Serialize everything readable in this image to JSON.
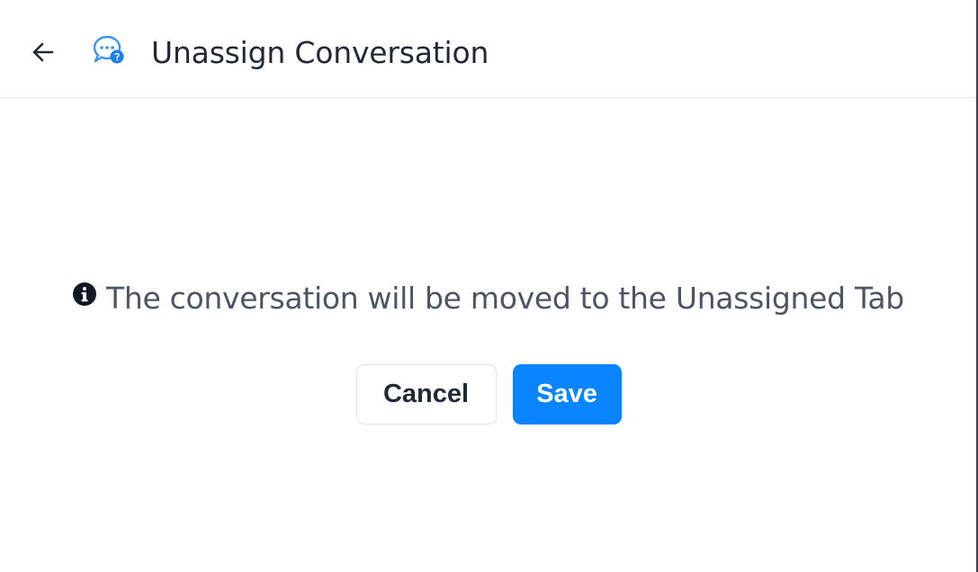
{
  "header": {
    "back_icon": "arrow-left-icon",
    "chat_icon": "chat-bubble-icon",
    "title": "Unassign Conversation"
  },
  "message": {
    "info_icon": "info-circle-icon",
    "text": "The conversation will be moved to the Unassigned Tab"
  },
  "actions": {
    "cancel_label": "Cancel",
    "save_label": "Save"
  },
  "colors": {
    "primary": "#0a84ff",
    "title_text": "#1f2937",
    "message_text": "#4b5563",
    "divider": "#e6e9ee"
  }
}
